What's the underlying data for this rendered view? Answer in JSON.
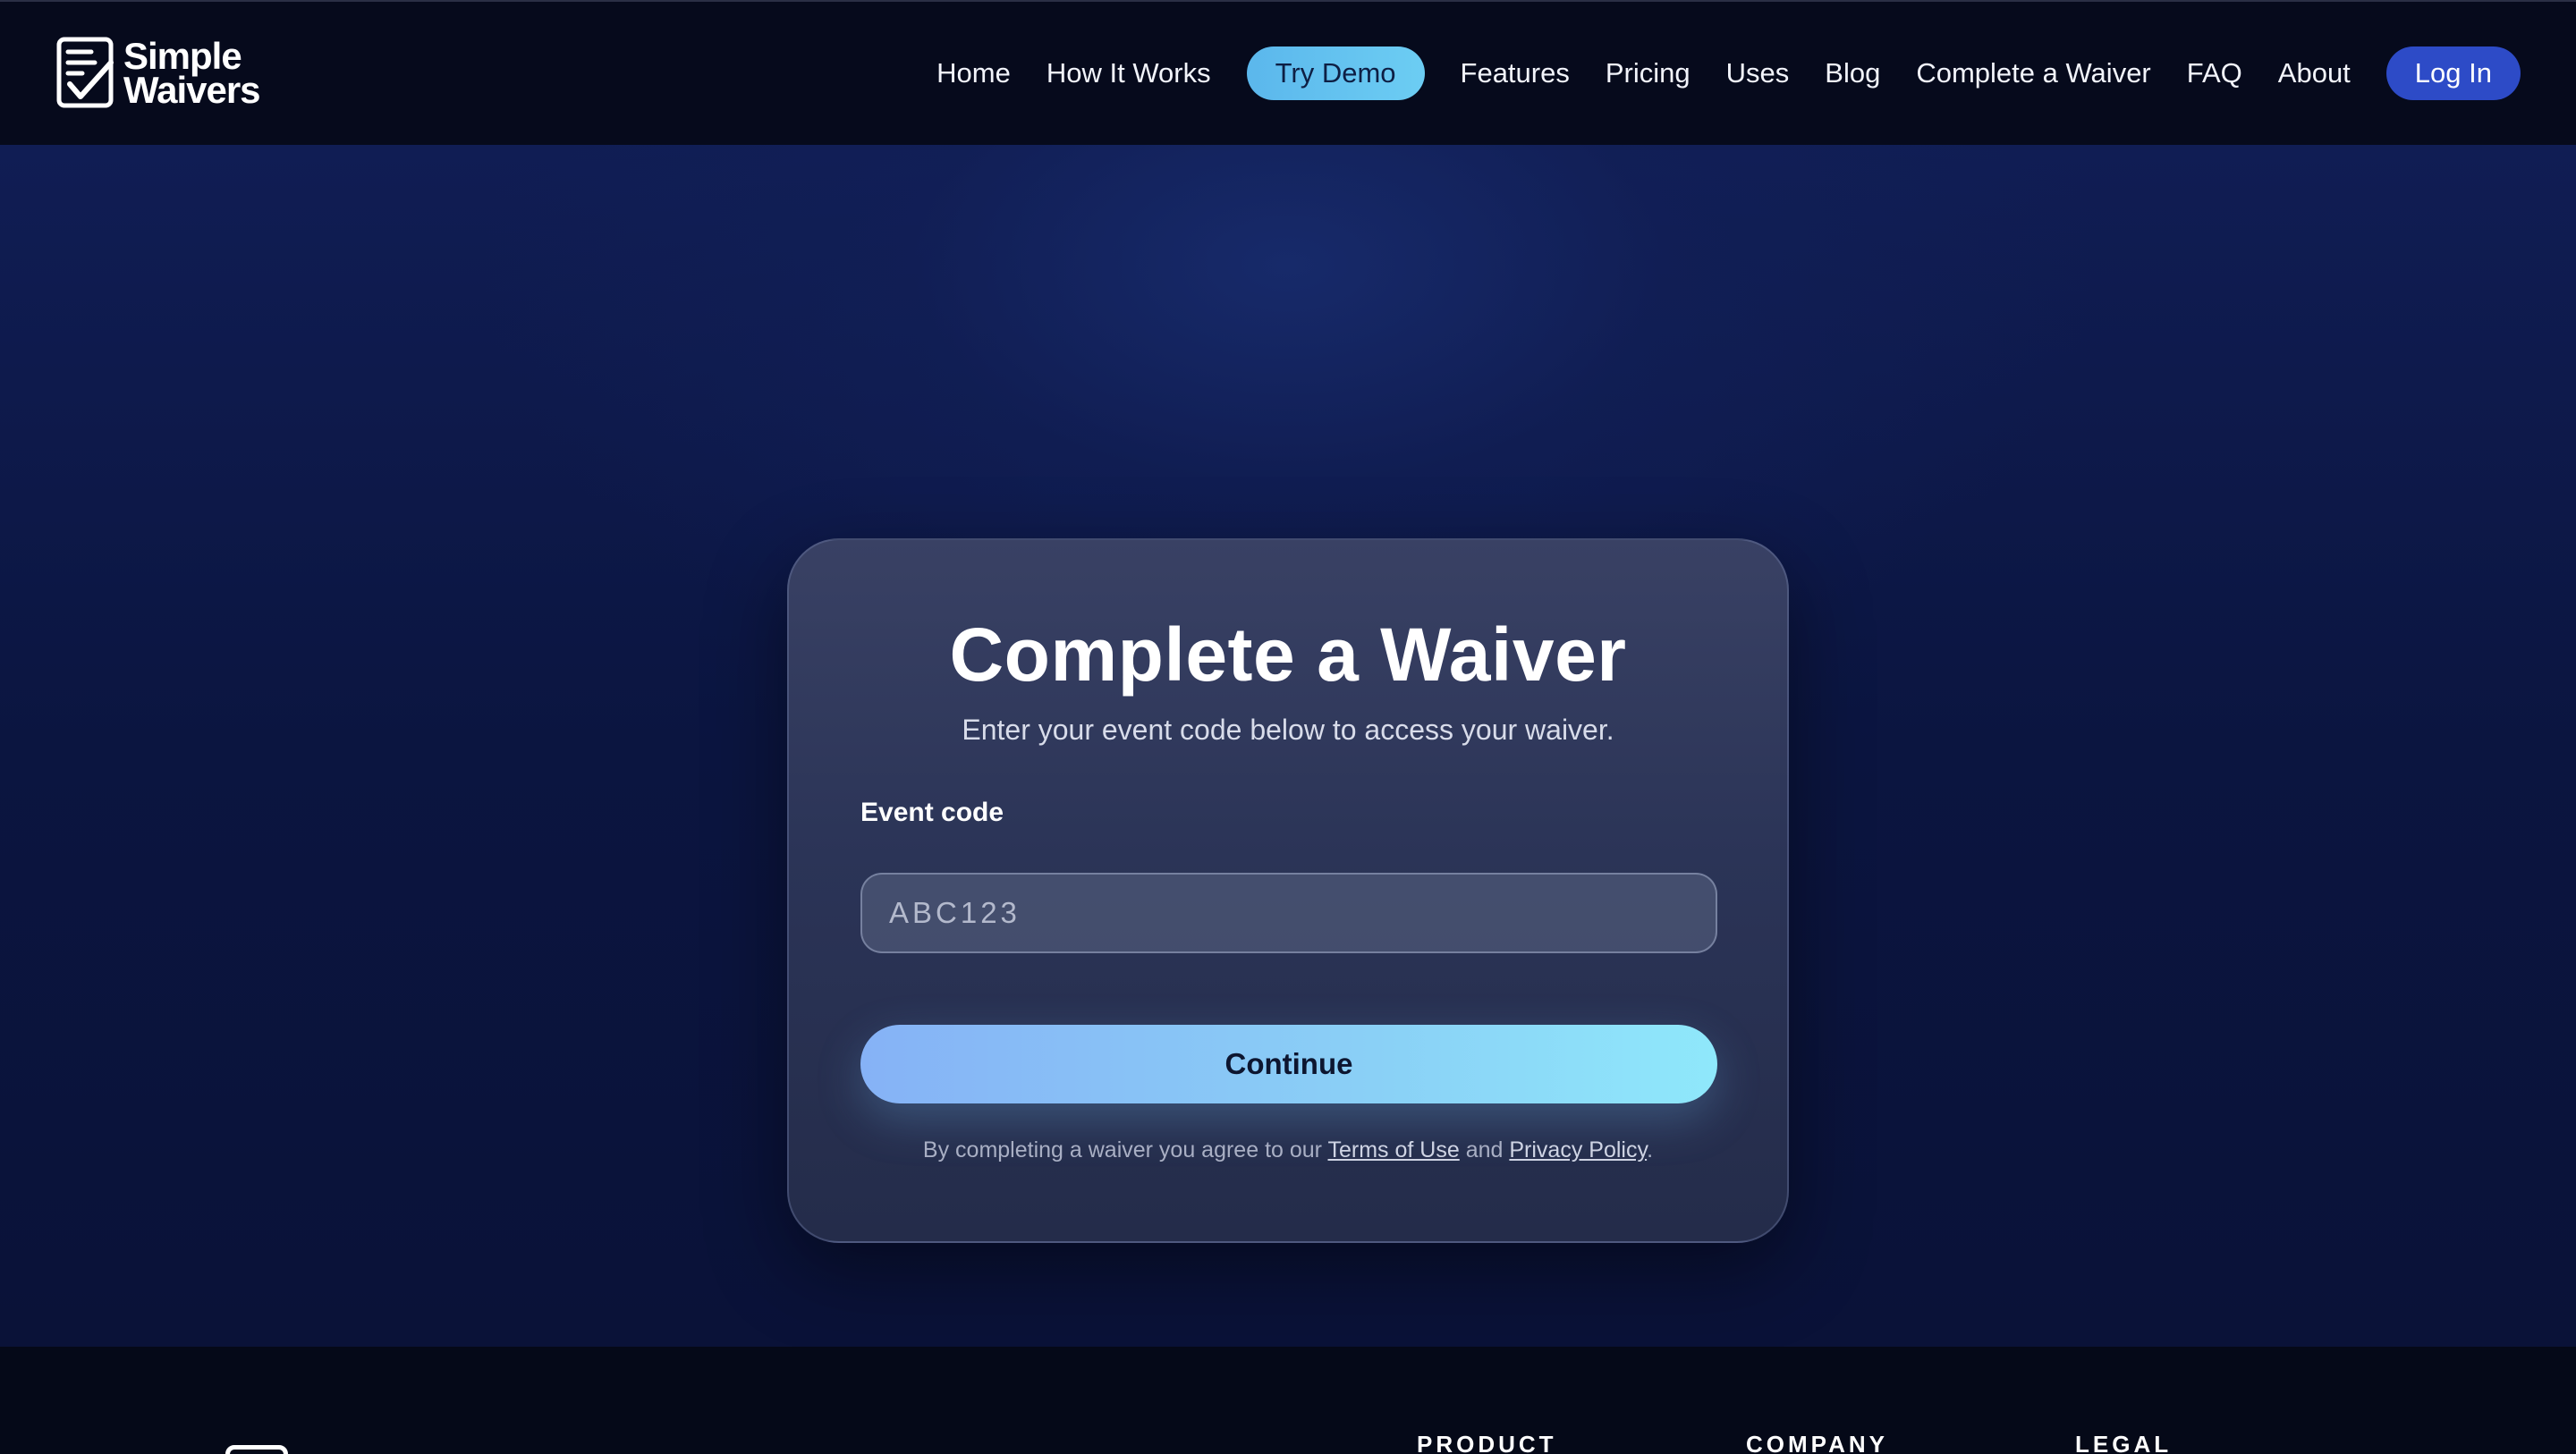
{
  "brand": {
    "line1": "Simple",
    "line2": "Waivers"
  },
  "nav": {
    "items": [
      {
        "label": "Home"
      },
      {
        "label": "How It Works"
      },
      {
        "label": "Try Demo"
      },
      {
        "label": "Features"
      },
      {
        "label": "Pricing"
      },
      {
        "label": "Uses"
      },
      {
        "label": "Blog"
      },
      {
        "label": "Complete a Waiver"
      },
      {
        "label": "FAQ"
      },
      {
        "label": "About"
      },
      {
        "label": "Log In"
      }
    ]
  },
  "card": {
    "title": "Complete a Waiver",
    "subtitle": "Enter your event code below to access your waiver.",
    "field_label": "Event code",
    "input_placeholder": "ABC123",
    "input_value": "",
    "continue_label": "Continue",
    "legal_prefix": "By completing a waiver you agree to our ",
    "terms_label": "Terms of Use",
    "legal_middle": " and ",
    "privacy_label": "Privacy Policy",
    "legal_suffix": "."
  },
  "footer": {
    "columns": [
      "PRODUCT",
      "COMPANY",
      "LEGAL"
    ]
  },
  "colors": {
    "background": "#0b1233",
    "header": "#060a1c",
    "try_demo": "#5bb7ec",
    "log_in": "#2d4bc7",
    "continue_start": "#86b2f6",
    "continue_end": "#8fe8fb"
  },
  "icons": {
    "logo": "document-check-icon"
  }
}
